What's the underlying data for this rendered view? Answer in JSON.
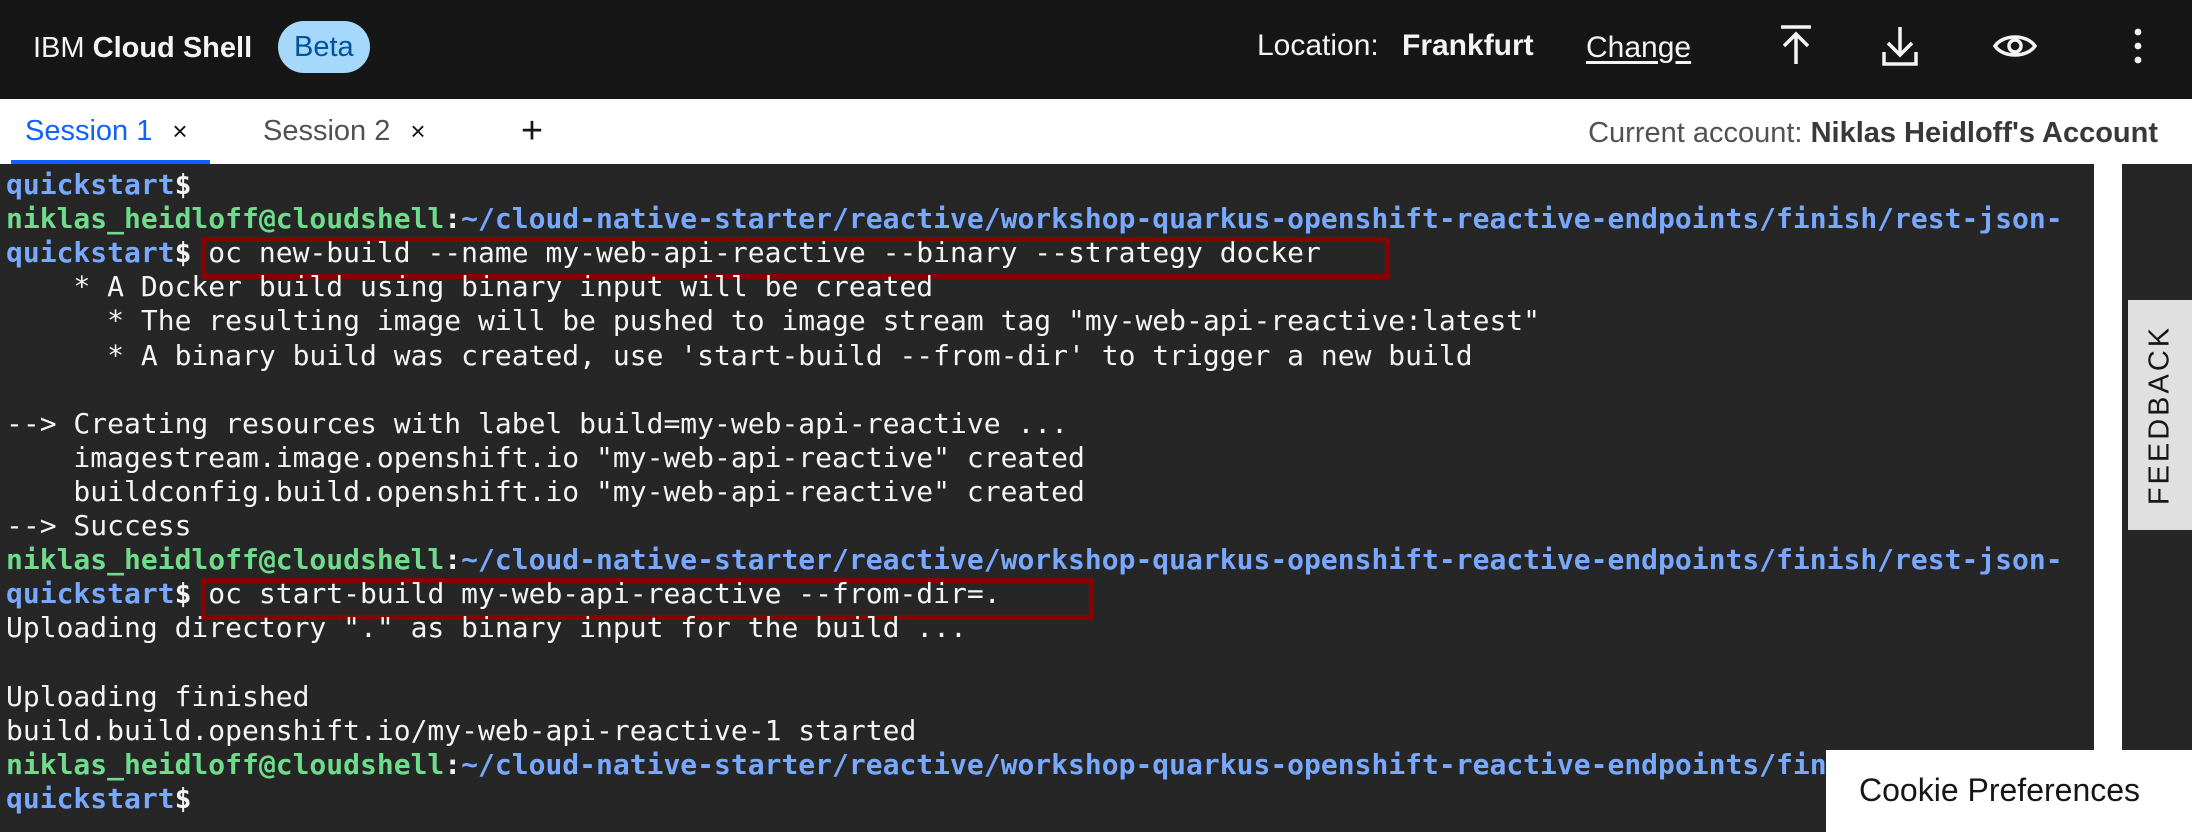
{
  "header": {
    "brand_prefix": "IBM",
    "brand_name": "Cloud Shell",
    "badge": "Beta",
    "location_label": "Location:",
    "location_value": "Frankfurt",
    "change_link": "Change"
  },
  "tabs": [
    {
      "label": "Session 1",
      "close": "×",
      "active": true
    },
    {
      "label": "Session 2",
      "close": "×",
      "active": false
    }
  ],
  "add_tab": "+",
  "account": {
    "label": "Current account:",
    "name": "Niklas Heidloff's Account"
  },
  "terminal": {
    "lines": [
      {
        "segments": [
          {
            "t": "quickstart",
            "c": "b"
          },
          {
            "t": "$",
            "c": "p"
          }
        ]
      },
      {
        "segments": [
          {
            "t": "niklas_heidloff@cloudshell",
            "c": "g"
          },
          {
            "t": ":",
            "c": "p"
          },
          {
            "t": "~/cloud-native-starter/reactive/workshop-quarkus-openshift-reactive-endpoints/finish/rest-json-",
            "c": "b"
          }
        ]
      },
      {
        "segments": [
          {
            "t": "quickstart",
            "c": "b"
          },
          {
            "t": "$ ",
            "c": "p"
          },
          {
            "t": "oc new-build --name my-web-api-reactive --binary --strategy docker",
            "c": ""
          }
        ]
      },
      {
        "segments": [
          {
            "t": "    * A Docker build using binary input will be created",
            "c": ""
          }
        ]
      },
      {
        "segments": [
          {
            "t": "      * The resulting image will be pushed to image stream tag \"my-web-api-reactive:latest\"",
            "c": ""
          }
        ]
      },
      {
        "segments": [
          {
            "t": "      * A binary build was created, use 'start-build --from-dir' to trigger a new build",
            "c": ""
          }
        ]
      },
      {
        "segments": [
          {
            "t": "",
            "c": ""
          }
        ]
      },
      {
        "segments": [
          {
            "t": "--> Creating resources with label build=my-web-api-reactive ...",
            "c": ""
          }
        ]
      },
      {
        "segments": [
          {
            "t": "    imagestream.image.openshift.io \"my-web-api-reactive\" created",
            "c": ""
          }
        ]
      },
      {
        "segments": [
          {
            "t": "    buildconfig.build.openshift.io \"my-web-api-reactive\" created",
            "c": ""
          }
        ]
      },
      {
        "segments": [
          {
            "t": "--> Success",
            "c": ""
          }
        ]
      },
      {
        "segments": [
          {
            "t": "niklas_heidloff@cloudshell",
            "c": "g"
          },
          {
            "t": ":",
            "c": "p"
          },
          {
            "t": "~/cloud-native-starter/reactive/workshop-quarkus-openshift-reactive-endpoints/finish/rest-json-",
            "c": "b"
          }
        ]
      },
      {
        "segments": [
          {
            "t": "quickstart",
            "c": "b"
          },
          {
            "t": "$ ",
            "c": "p"
          },
          {
            "t": "oc start-build my-web-api-reactive --from-dir=.",
            "c": ""
          }
        ]
      },
      {
        "segments": [
          {
            "t": "Uploading directory \".\" as binary input for the build ...",
            "c": ""
          }
        ]
      },
      {
        "segments": [
          {
            "t": "",
            "c": ""
          }
        ]
      },
      {
        "segments": [
          {
            "t": "Uploading finished",
            "c": ""
          }
        ]
      },
      {
        "segments": [
          {
            "t": "build.build.openshift.io/my-web-api-reactive-1 started",
            "c": ""
          }
        ]
      },
      {
        "segments": [
          {
            "t": "niklas_heidloff@cloudshell",
            "c": "g"
          },
          {
            "t": ":",
            "c": "p"
          },
          {
            "t": "~/cloud-native-starter/reactive/workshop-quarkus-openshift-reactive-endpoints/finish/rest-json-",
            "c": "b"
          }
        ]
      },
      {
        "segments": [
          {
            "t": "quickstart",
            "c": "b"
          },
          {
            "t": "$",
            "c": "p"
          }
        ]
      }
    ]
  },
  "feedback": "FEEDBACK",
  "cookie": "Cookie Preferences",
  "icons": {
    "upload": "upload-icon",
    "download": "download-icon",
    "view": "eye-icon",
    "menu": "overflow-menu-icon"
  },
  "colors": {
    "header_bg": "#161616",
    "terminal_bg": "#262626",
    "prompt_user": "#6fdc8c",
    "prompt_path": "#78a9ff",
    "tab_active": "#0f62fe",
    "badge_bg": "#a6d8fb",
    "highlight_box": "#8a0000"
  }
}
